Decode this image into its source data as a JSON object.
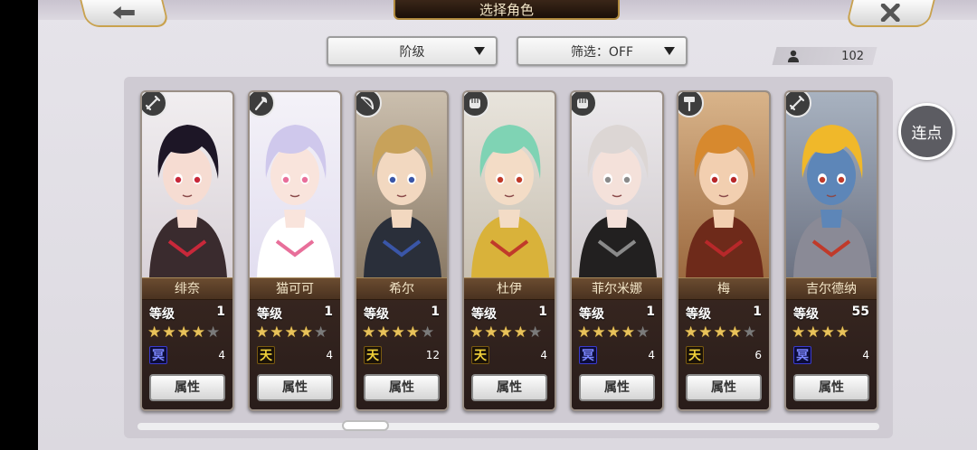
{
  "header": {
    "title": "选择角色"
  },
  "nav": {
    "back_icon": "back-arrow-icon",
    "close_icon": "close-x-icon"
  },
  "filters": {
    "sort_label": "阶级",
    "filter_label": "筛选：OFF"
  },
  "roster": {
    "count": "102",
    "icon": "user-icon"
  },
  "buttons": {
    "lianpai": "连点"
  },
  "colors": {
    "gold": "#e8c25a",
    "card_bg": "#2a1d18",
    "rank_heaven": "#f1d23a",
    "rank_blue": "#3a3acf"
  },
  "cards": [
    {
      "name": "绯奈",
      "level_label": "等级",
      "level": "1",
      "stars": 4,
      "max_stars": 5,
      "rank_icon": "rank-blue-icon",
      "rank_char": "冥",
      "rank_count": "4",
      "attr_label": "属性",
      "weapon_icon": "sword-icon"
    },
    {
      "name": "猫可可",
      "level_label": "等级",
      "level": "1",
      "stars": 4,
      "max_stars": 5,
      "rank_icon": "rank-heaven-icon",
      "rank_char": "天",
      "rank_count": "4",
      "attr_label": "属性",
      "weapon_icon": "axe-icon"
    },
    {
      "name": "希尔",
      "level_label": "等级",
      "level": "1",
      "stars": 4,
      "max_stars": 5,
      "rank_icon": "rank-heaven-icon",
      "rank_char": "天",
      "rank_count": "12",
      "attr_label": "属性",
      "weapon_icon": "bow-icon"
    },
    {
      "name": "杜伊",
      "level_label": "等级",
      "level": "1",
      "stars": 4,
      "max_stars": 5,
      "rank_icon": "rank-heaven-icon",
      "rank_char": "天",
      "rank_count": "4",
      "attr_label": "属性",
      "weapon_icon": "fist-icon"
    },
    {
      "name": "菲尔米娜",
      "level_label": "等级",
      "level": "1",
      "stars": 4,
      "max_stars": 5,
      "rank_icon": "rank-blue-icon",
      "rank_char": "冥",
      "rank_count": "4",
      "attr_label": "属性",
      "weapon_icon": "fist-icon"
    },
    {
      "name": "梅",
      "level_label": "等级",
      "level": "1",
      "stars": 4,
      "max_stars": 5,
      "rank_icon": "rank-heaven-icon",
      "rank_char": "天",
      "rank_count": "6",
      "attr_label": "属性",
      "weapon_icon": "hammer-icon"
    },
    {
      "name": "吉尔德纳",
      "level_label": "等级",
      "level": "55",
      "stars": 4,
      "max_stars": 4,
      "rank_icon": "rank-blue-icon",
      "rank_char": "冥",
      "rank_count": "4",
      "attr_label": "属性",
      "weapon_icon": "sword-icon"
    }
  ]
}
